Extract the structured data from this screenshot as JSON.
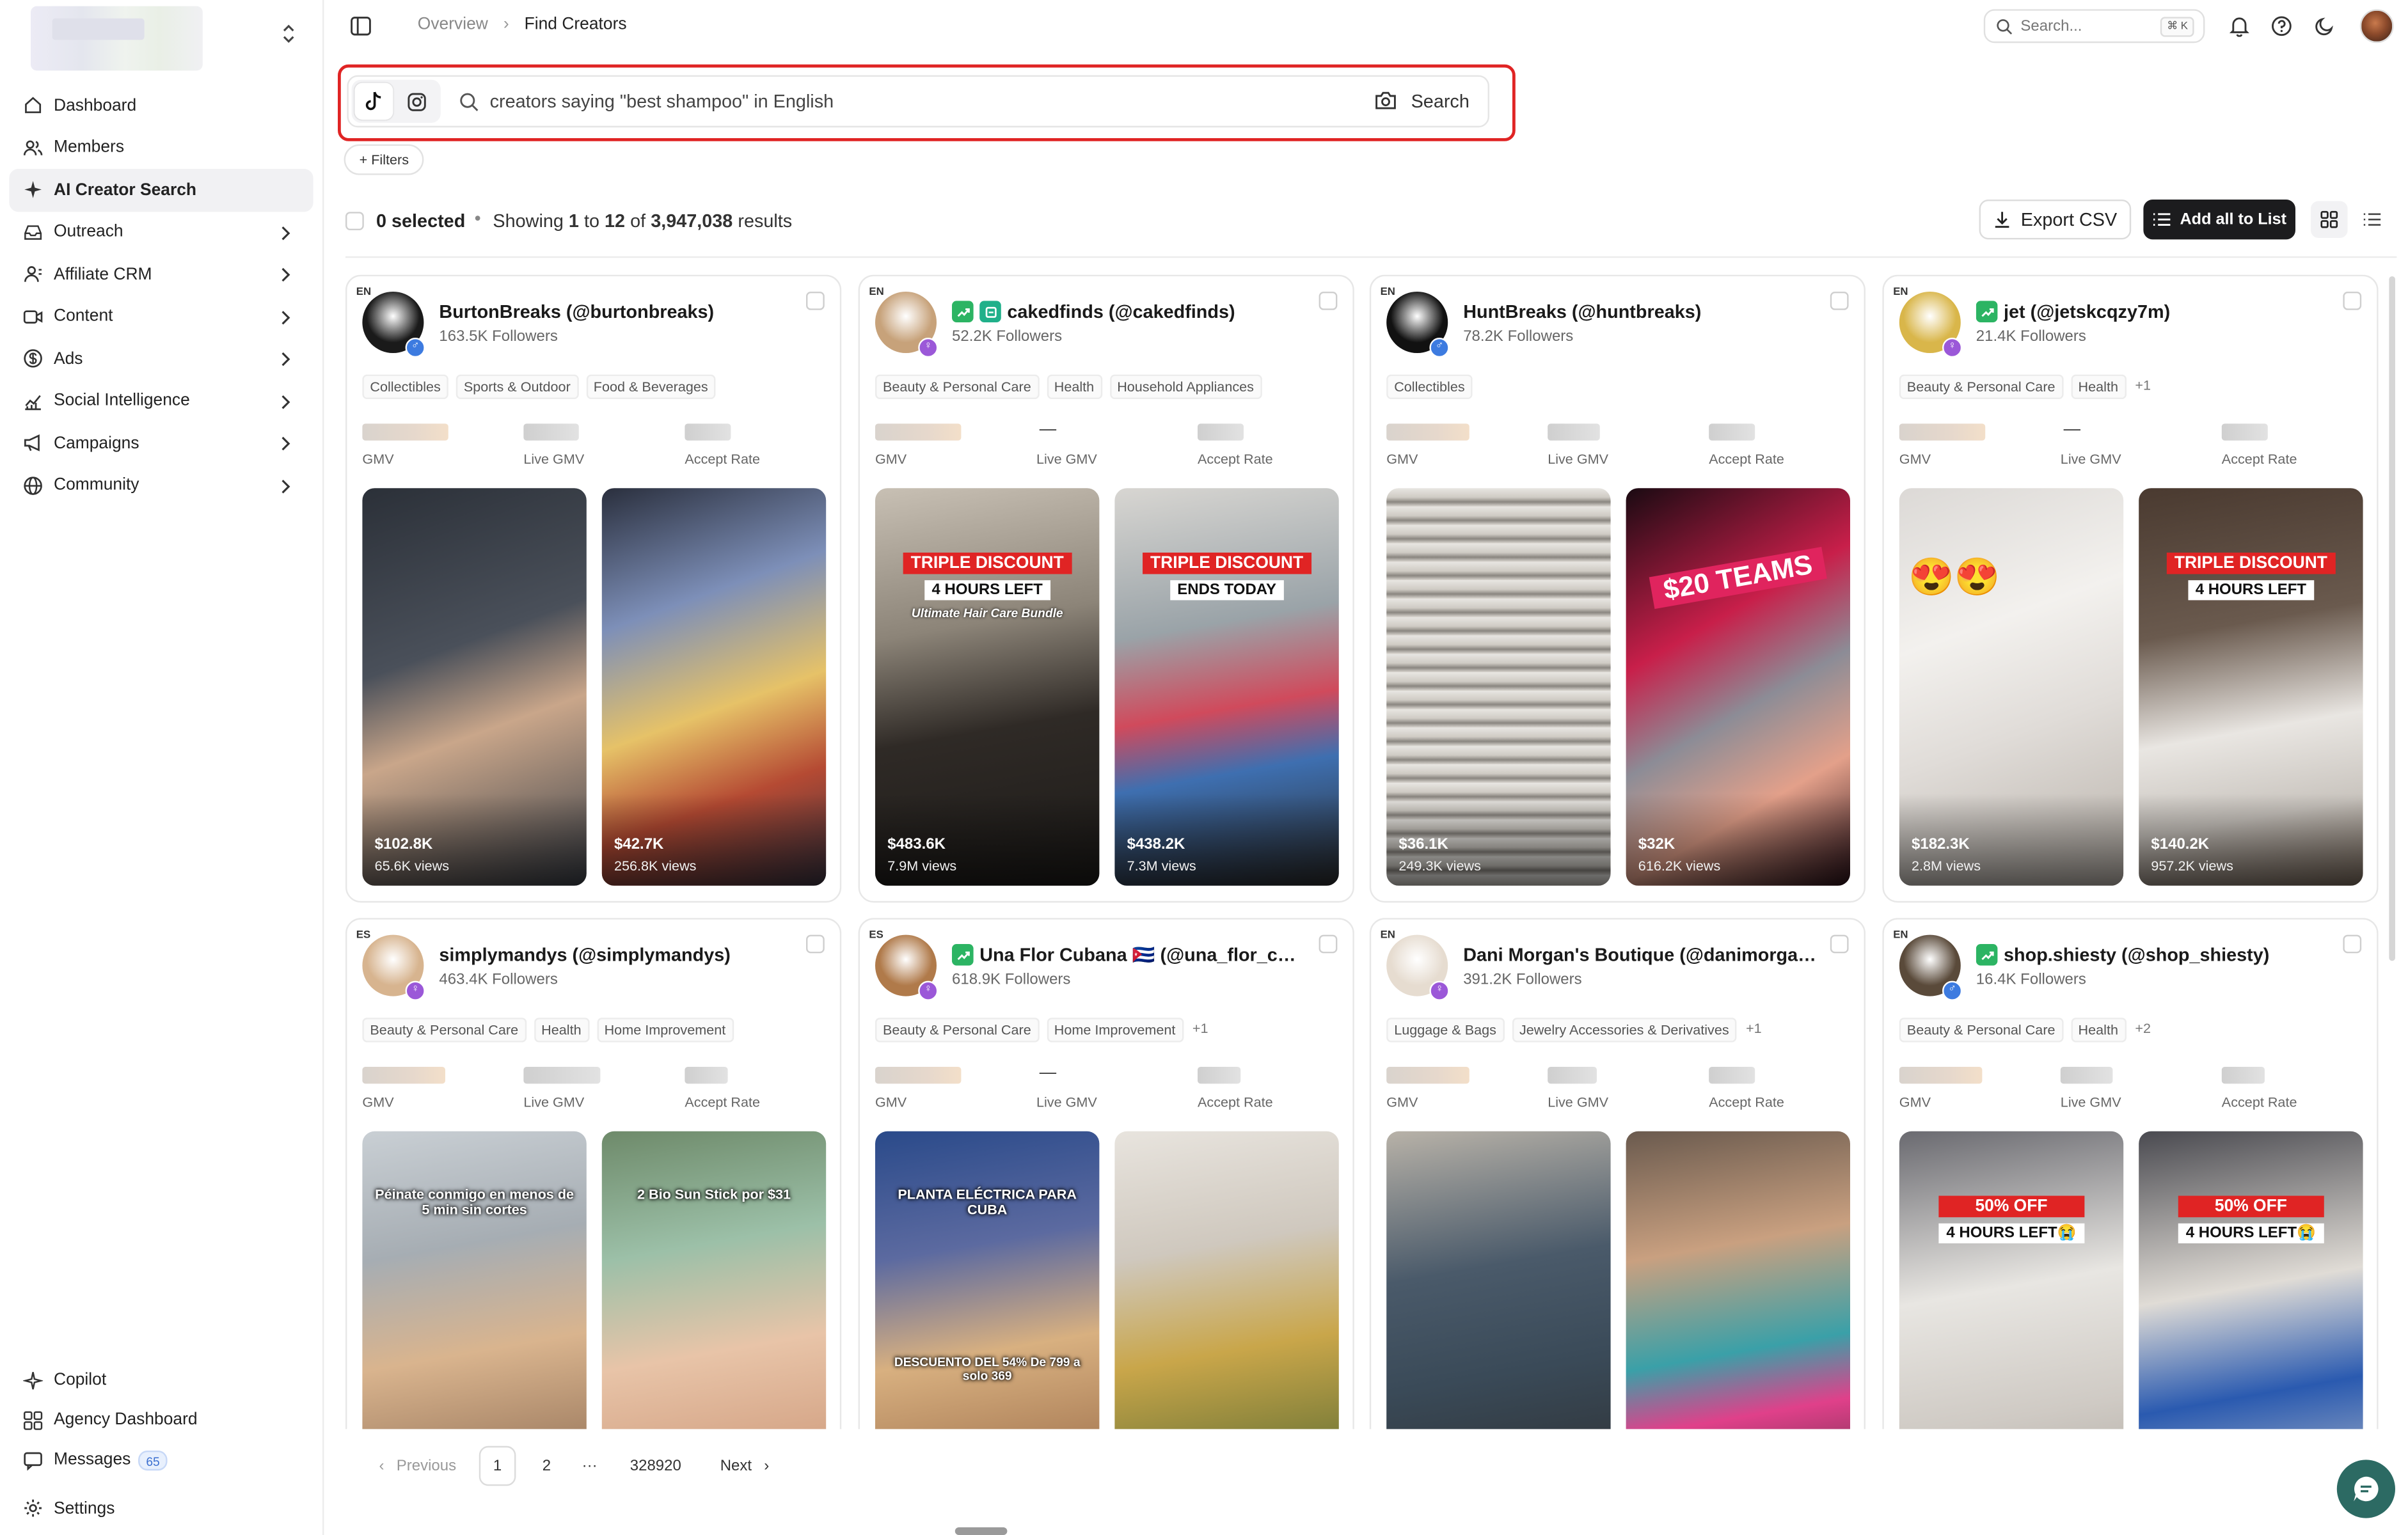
{
  "sidebar": {
    "nav": [
      {
        "label": "Dashboard",
        "icon": "home-icon",
        "chevron": false,
        "active": false
      },
      {
        "label": "Members",
        "icon": "users-icon",
        "chevron": false,
        "active": false
      },
      {
        "label": "AI Creator Search",
        "icon": "sparkles-icon",
        "chevron": false,
        "active": true
      },
      {
        "label": "Outreach",
        "icon": "inbox-icon",
        "chevron": true,
        "active": false
      },
      {
        "label": "Affiliate CRM",
        "icon": "contacts-icon",
        "chevron": true,
        "active": false
      },
      {
        "label": "Content",
        "icon": "video-icon",
        "chevron": true,
        "active": false
      },
      {
        "label": "Ads",
        "icon": "dollar-icon",
        "chevron": true,
        "active": false
      },
      {
        "label": "Social Intelligence",
        "icon": "chart-icon",
        "chevron": true,
        "active": false
      },
      {
        "label": "Campaigns",
        "icon": "megaphone-icon",
        "chevron": true,
        "active": false
      },
      {
        "label": "Community",
        "icon": "globe-icon",
        "chevron": true,
        "active": false
      }
    ],
    "bottom": [
      {
        "label": "Copilot",
        "icon": "copilot-icon"
      },
      {
        "label": "Agency Dashboard",
        "icon": "grid-icon"
      },
      {
        "label": "Messages",
        "icon": "message-icon",
        "badge": "65"
      },
      {
        "label": "Settings",
        "icon": "gear-icon"
      }
    ]
  },
  "topbar": {
    "breadcrumb": [
      "Overview",
      "Find Creators"
    ],
    "search_placeholder": "Search...",
    "search_shortcut": "⌘ K"
  },
  "search": {
    "query": "creators saying \"best shampoo\" in English",
    "button": "Search",
    "filters_label": "+ Filters",
    "platforms": [
      "tiktok",
      "instagram"
    ],
    "highlight_color": "#e02424"
  },
  "results": {
    "selected": "0 selected",
    "showing_prefix": "Showing",
    "from": "1",
    "to_word": "to",
    "to": "12",
    "of_word": "of",
    "total": "3,947,038",
    "results_word": "results",
    "export_label": "Export CSV",
    "add_all_label": "Add all to List"
  },
  "stat_labels": {
    "gmv": "GMV",
    "live_gmv": "Live GMV",
    "accept_rate": "Accept Rate"
  },
  "creators": [
    {
      "lang": "EN",
      "name": "BurtonBreaks (@burtonbreaks)",
      "followers": "163.5K Followers",
      "gender": "male",
      "trend": false,
      "shop": false,
      "live_gmv_dash": false,
      "tags": [
        "Collectibles",
        "Sports & Outdoor",
        "Food & Beverages"
      ],
      "avatar_color": "#1a1a1a",
      "videos": [
        {
          "gmv": "$102.8K",
          "views": "65.6K views",
          "bg": "linear-gradient(160deg,#2b3038 0%,#4a505a 40%,#c9a68a 60%,#3a3f47 100%)"
        },
        {
          "gmv": "$42.7K",
          "views": "256.8K views",
          "bg": "linear-gradient(160deg,#2a2f3d 0%,#7d8fb8 30%,#e6c268 55%,#b54a33 75%,#3a3340 100%)"
        }
      ]
    },
    {
      "lang": "EN",
      "name": "cakedfinds (@cakedfinds)",
      "followers": "52.2K Followers",
      "gender": "female",
      "trend": true,
      "shop": true,
      "live_gmv_dash": true,
      "tags": [
        "Beauty & Personal Care",
        "Health",
        "Household Appliances"
      ],
      "avatar_color": "#c7a27a",
      "videos": [
        {
          "gmv": "$483.6K",
          "views": "7.9M views",
          "bg": "linear-gradient(170deg,#c8c0b4 0%,#8c8478 35%,#2f2a26 60%,#1c1a18 100%)",
          "promo_red": "TRIPLE DISCOUNT",
          "promo_white": "4 HOURS LEFT",
          "promo_sub": "Ultimate Hair Care Bundle"
        },
        {
          "gmv": "$438.2K",
          "views": "7.3M views",
          "bg": "linear-gradient(170deg,#d8d6d2 0%,#9aa3a8 35%,#d04a5c 55%,#3e6fb0 70%,#2a2a2a 100%)",
          "promo_red": "TRIPLE DISCOUNT",
          "promo_white": "ENDS TODAY"
        }
      ]
    },
    {
      "lang": "EN",
      "name": "HuntBreaks (@huntbreaks)",
      "followers": "78.2K Followers",
      "gender": "male",
      "trend": false,
      "shop": false,
      "live_gmv_dash": false,
      "tags": [
        "Collectibles"
      ],
      "avatar_color": "#111111",
      "videos": [
        {
          "gmv": "$36.1K",
          "views": "249.3K views",
          "bg": "repeating-linear-gradient(180deg,#e8e6e2 0px,#cfcbc4 6px,#8a8680 9px,#dcd8d2 12px)"
        },
        {
          "gmv": "$32K",
          "views": "616.2K views",
          "bg": "linear-gradient(150deg,#1a0a12 0%,#c81f4a 35%,#8c8c96 55%,#e3a08a 75%,#2a1018 100%)",
          "overlay": "$20 TEAMS"
        }
      ]
    },
    {
      "lang": "EN",
      "name": "jet (@jetskcqzy7m)",
      "followers": "21.4K Followers",
      "gender": "female",
      "trend": true,
      "shop": false,
      "live_gmv_dash": true,
      "tags": [
        "Beauty & Personal Care",
        "Health",
        "+1"
      ],
      "avatar_color": "#d9b64a",
      "videos": [
        {
          "gmv": "$182.3K",
          "views": "2.8M views",
          "bg": "linear-gradient(160deg,#dcd9d6 0%,#f3f1ee 35%,#e0dcd8 60%,#b7b0a8 100%)",
          "emoji": "😍😍"
        },
        {
          "gmv": "$140.2K",
          "views": "957.2K views",
          "bg": "linear-gradient(170deg,#4a3a30 0%,#6a5a4e 35%,#e9e6e2 60%,#c9c4be 80%,#7a6a5c 100%)",
          "promo_red": "TRIPLE DISCOUNT",
          "promo_white": "4 HOURS LEFT"
        }
      ]
    },
    {
      "lang": "ES",
      "name": "simplymandys (@simplymandys)",
      "followers": "463.4K Followers",
      "gender": "female",
      "trend": false,
      "shop": false,
      "live_gmv_dash": false,
      "tags": [
        "Beauty & Personal Care",
        "Health",
        "Home Improvement"
      ],
      "avatar_color": "#d7b48f",
      "videos": [
        {
          "gmv": "",
          "views": "",
          "bg": "linear-gradient(170deg,#c9cfd4 0%,#a6adb3 30%,#d9b48e 55%,#7a5a44 100%)",
          "caption": "Péinate conmigo en menos de 5 min sin cortes"
        },
        {
          "gmv": "",
          "views": "",
          "bg": "linear-gradient(170deg,#6e8a6a 0%,#9cc0a8 30%,#e8c4a8 55%,#c48a6a 100%)",
          "caption": "2 Bio Sun Stick por $31"
        }
      ]
    },
    {
      "lang": "ES",
      "name": "Una Flor Cubana 🇨🇺 (@una_flor_cu…",
      "followers": "618.9K Followers",
      "gender": "female",
      "trend": true,
      "shop": false,
      "live_gmv_dash": true,
      "tags": [
        "Beauty & Personal Care",
        "Home Improvement",
        "+1"
      ],
      "avatar_color": "#b07a4a",
      "videos": [
        {
          "gmv": "",
          "views": "",
          "bg": "linear-gradient(170deg,#2a4a8a 0%,#5c6aa0 30%,#d8b080 55%,#8a5a3a 100%)",
          "caption": "PLANTA ELÉCTRICA PARA CUBA",
          "caption2": "DESCUENTO DEL 54% De 799 a solo 369"
        },
        {
          "gmv": "",
          "views": "",
          "bg": "linear-gradient(170deg,#e8e4de 0%,#cfc8be 30%,#c9a64a 55%,#3a5a2a 100%)"
        }
      ]
    },
    {
      "lang": "EN",
      "name": "Dani Morgan's Boutique (@danimorga…",
      "followers": "391.2K Followers",
      "gender": "female",
      "trend": false,
      "shop": false,
      "live_gmv_dash": false,
      "tags": [
        "Luggage & Bags",
        "Jewelry Accessories & Derivatives",
        "+1"
      ],
      "avatar_color": "#e6dcd0",
      "videos": [
        {
          "gmv": "",
          "views": "",
          "bg": "linear-gradient(170deg,#b8b2a8 0%,#4a5a6a 35%,#3a4a58 60%,#2a2a2a 100%)"
        },
        {
          "gmv": "",
          "views": "",
          "bg": "linear-gradient(170deg,#6a5a4e 0%,#c9a080 30%,#3aa0a8 55%,#e0408a 70%,#2a2a2a 100%)"
        }
      ]
    },
    {
      "lang": "EN",
      "name": "shop.shiesty (@shop_shiesty)",
      "followers": "16.4K Followers",
      "gender": "male",
      "trend": true,
      "shop": false,
      "live_gmv_dash": false,
      "tags": [
        "Beauty & Personal Care",
        "Health",
        "+2"
      ],
      "avatar_color": "#5a4a3a",
      "videos": [
        {
          "gmv": "",
          "views": "",
          "bg": "linear-gradient(170deg,#6a6a70 0%,#e8e6e2 40%,#cfcac4 70%,#a8a29a 100%)",
          "promo_red": "50% OFF",
          "promo_white": "4 HOURS LEFT😭"
        },
        {
          "gmv": "",
          "views": "",
          "bg": "linear-gradient(170deg,#4a4a50 0%,#e0dcd6 40%,#2a5ab0 65%,#d8d4ce 100%)",
          "promo_red": "50% OFF",
          "promo_white": "4 HOURS LEFT😭"
        }
      ]
    }
  ],
  "pagination": {
    "previous": "Previous",
    "pages": [
      "1",
      "2"
    ],
    "current": "1",
    "ellipsis": "···",
    "last": "328920",
    "next": "Next"
  }
}
